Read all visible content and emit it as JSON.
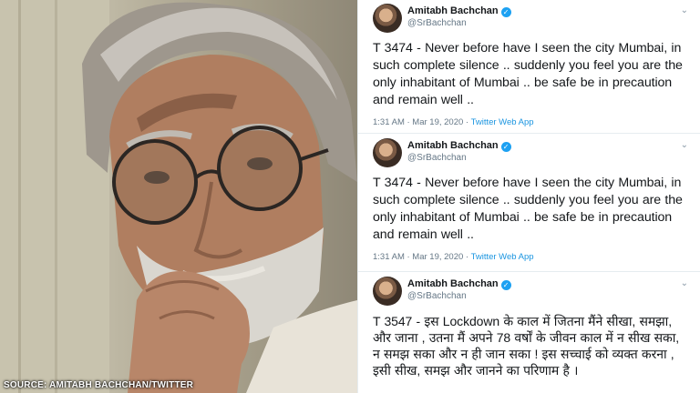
{
  "photo": {
    "caption": "SOURCE: AMITABH BACHCHAN/TWITTER"
  },
  "tweets": [
    {
      "author_name": "Amitabh Bachchan",
      "handle": "@SrBachchan",
      "text": "T 3474 - Never before have I seen the city Mumbai, in such complete silence .. suddenly you feel you are the only inhabitant of Mumbai .. be safe be in precaution and remain well ..",
      "time": "1:31 AM · Mar 19, 2020",
      "client": "Twitter Web App"
    },
    {
      "author_name": "Amitabh Bachchan",
      "handle": "@SrBachchan",
      "text": "T 3474 - Never before have I seen the city Mumbai, in such complete silence .. suddenly you feel you are the only inhabitant of Mumbai .. be safe be in precaution and remain well ..",
      "time": "1:31 AM · Mar 19, 2020",
      "client": "Twitter Web App"
    },
    {
      "author_name": "Amitabh Bachchan",
      "handle": "@SrBachchan",
      "text": "T 3547 -  इस Lockdown के काल में जितना मैंने सीखा, समझा, और जाना , उतना मैं अपने 78 वर्षों के जीवन काल में न सीख सका, न समझ सका और न ही जान सका  ! इस सच्चाई को व्यक्त करना , इसी सीख, समझ और जानने का परिणाम है ।"
    }
  ],
  "colors": {
    "verified": "#1da1f2",
    "link": "#1b95e0",
    "meta": "#657786",
    "text": "#14171a"
  }
}
